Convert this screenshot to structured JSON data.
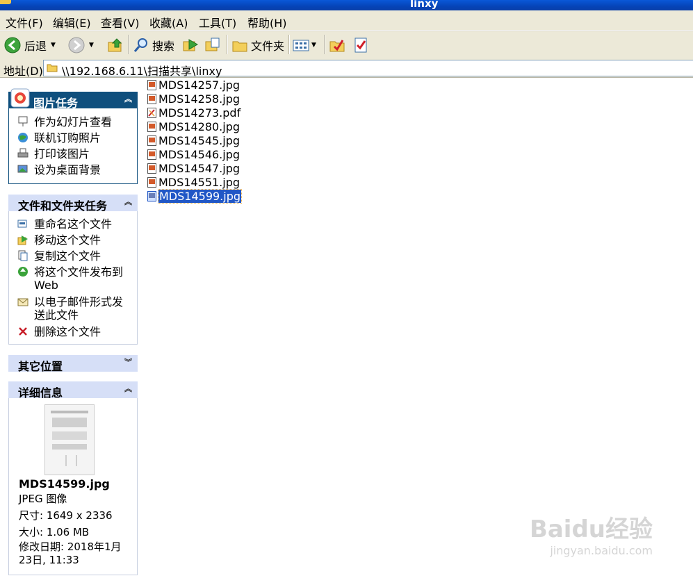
{
  "window": {
    "title": "linxy"
  },
  "menu": [
    {
      "label": "文件(F)"
    },
    {
      "label": "编辑(E)"
    },
    {
      "label": "查看(V)"
    },
    {
      "label": "收藏(A)"
    },
    {
      "label": "工具(T)"
    },
    {
      "label": "帮助(H)"
    }
  ],
  "toolbar": {
    "back": "后退",
    "search": "搜索",
    "folders": "文件夹"
  },
  "address": {
    "label": "地址(D)",
    "value": "\\\\192.168.6.11\\扫描共享\\linxy"
  },
  "picture_tasks": {
    "title": "图片任务",
    "items": [
      "作为幻灯片查看",
      "联机订购照片",
      "打印该图片",
      "设为桌面背景"
    ]
  },
  "file_tasks": {
    "title": "文件和文件夹任务",
    "items": [
      "重命名这个文件",
      "移动这个文件",
      "复制这个文件",
      "将这个文件发布到 Web",
      "以电子邮件形式发送此文件",
      "删除这个文件"
    ]
  },
  "other_places": {
    "title": "其它位置"
  },
  "details": {
    "title": "详细信息",
    "filename": "MDS14599.jpg",
    "type": "JPEG 图像",
    "dimensions": "尺寸: 1649 x 2336",
    "size": "大小: 1.06 MB",
    "modified": "修改日期: 2018年1月 23日, 11:33"
  },
  "files": [
    {
      "name": "MDS14257.jpg",
      "type": "jpg"
    },
    {
      "name": "MDS14258.jpg",
      "type": "jpg"
    },
    {
      "name": "MDS14273.pdf",
      "type": "pdf"
    },
    {
      "name": "MDS14280.jpg",
      "type": "jpg"
    },
    {
      "name": "MDS14545.jpg",
      "type": "jpg"
    },
    {
      "name": "MDS14546.jpg",
      "type": "jpg"
    },
    {
      "name": "MDS14547.jpg",
      "type": "jpg"
    },
    {
      "name": "MDS14551.jpg",
      "type": "jpg"
    },
    {
      "name": "MDS14599.jpg",
      "type": "jpg",
      "selected": true
    }
  ],
  "watermark": {
    "brand": "Baidu经验",
    "url": "jingyan.baidu.com"
  },
  "colors": {
    "title_bar": "#0a58d8",
    "selection": "#2157c6",
    "panel_dark": "#0f4f7d",
    "panel_light": "#d6dff7",
    "chrome": "#ece9d8"
  }
}
